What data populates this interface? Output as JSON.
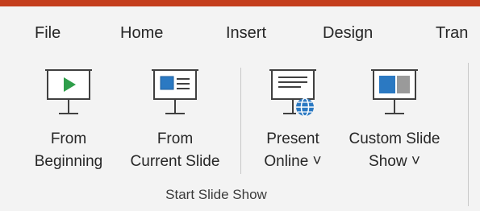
{
  "menu": {
    "tabs": [
      "File",
      "Home",
      "Insert",
      "Design",
      "Tran"
    ]
  },
  "ribbon": {
    "buttons": [
      {
        "line1": "From",
        "line2": "Beginning"
      },
      {
        "line1": "From",
        "line2": "Current Slide"
      },
      {
        "line1": "Present",
        "line2": "Online ˅"
      },
      {
        "line1": "Custom Slide",
        "line2": "Show ˅"
      }
    ],
    "group_label": "Start Slide Show"
  },
  "colors": {
    "accent_bar": "#c43e1c",
    "arrow": "#c0392b",
    "play_triangle": "#2e9e4a",
    "icon_blue": "#2b79c2"
  }
}
